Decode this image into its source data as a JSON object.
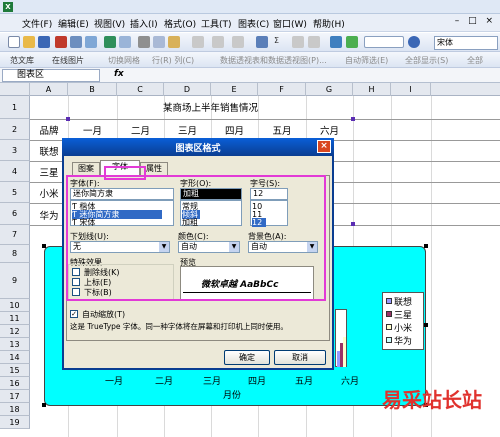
{
  "window": {
    "app_icon": "excel-icon"
  },
  "menu": [
    "文件(F)",
    "编辑(E)",
    "视图(V)",
    "插入(I)",
    "格式(O)",
    "工具(T)",
    "图表(C)",
    "窗口(W)",
    "帮助(H)"
  ],
  "toolbar": {
    "font_name": "宋体",
    "row2": [
      "范文库",
      "在线图片",
      "切换网格",
      "行(R) 列(C)",
      "数据透视表和数据透视图(P)...",
      "自动筛选(E)",
      "全部显示(S)",
      "全部"
    ]
  },
  "formula_bar": {
    "name_box": "图表区",
    "fx": "fx"
  },
  "sheet": {
    "columns": [
      "A",
      "B",
      "C",
      "D",
      "E",
      "F",
      "G",
      "H",
      "I"
    ],
    "rows": [
      "1",
      "2",
      "3",
      "4",
      "5",
      "6",
      "7",
      "8",
      "9",
      "10",
      "11",
      "12",
      "13",
      "14",
      "15",
      "16",
      "17",
      "18",
      "19"
    ],
    "title": "某商场上半年销售情况",
    "header": [
      "品牌",
      "一月",
      "二月",
      "三月",
      "四月",
      "五月",
      "六月"
    ],
    "brands": [
      "联想",
      "三星",
      "小米",
      "华为"
    ]
  },
  "chart": {
    "months": [
      "一月",
      "二月",
      "三月",
      "四月",
      "五月",
      "六月"
    ],
    "xlabel": "月份",
    "legend": [
      "联想",
      "三星",
      "小米",
      "华为"
    ],
    "colors": [
      "#9999ff",
      "#993366",
      "#ffffcc",
      "#ccffff"
    ]
  },
  "dialog": {
    "title": "图表区格式",
    "close": "×",
    "tabs": [
      "图案",
      "字体",
      "属性"
    ],
    "font_label": "字体(F):",
    "font_value": "迷你简方隶",
    "font_list": [
      "Ƭ 楷体",
      "Ƭ 迷你简方隶",
      "Ƭ 宋体"
    ],
    "style_label": "字形(O):",
    "style_value": "加粗",
    "style_list": [
      "常规",
      "倾斜",
      "加粗"
    ],
    "size_label": "字号(S):",
    "size_value": "12",
    "size_list": [
      "10",
      "11",
      "12"
    ],
    "underline_label": "下划线(U):",
    "underline_value": "无",
    "color_label": "颜色(C):",
    "color_value": "自动",
    "bg_label": "背景色(A):",
    "bg_value": "自动",
    "effects_label": "特殊效果",
    "effects": [
      "删除线(K)",
      "上标(E)",
      "下标(B)"
    ],
    "preview_label": "预览",
    "preview_text": "微软卓越  AaBbCc",
    "autoscale_label": "自动缩放(T)",
    "note": "这是 TrueType 字体。同一种字体将在屏幕和打印机上同时使用。",
    "ok": "确定",
    "cancel": "取消"
  },
  "watermark": "易采站长站"
}
